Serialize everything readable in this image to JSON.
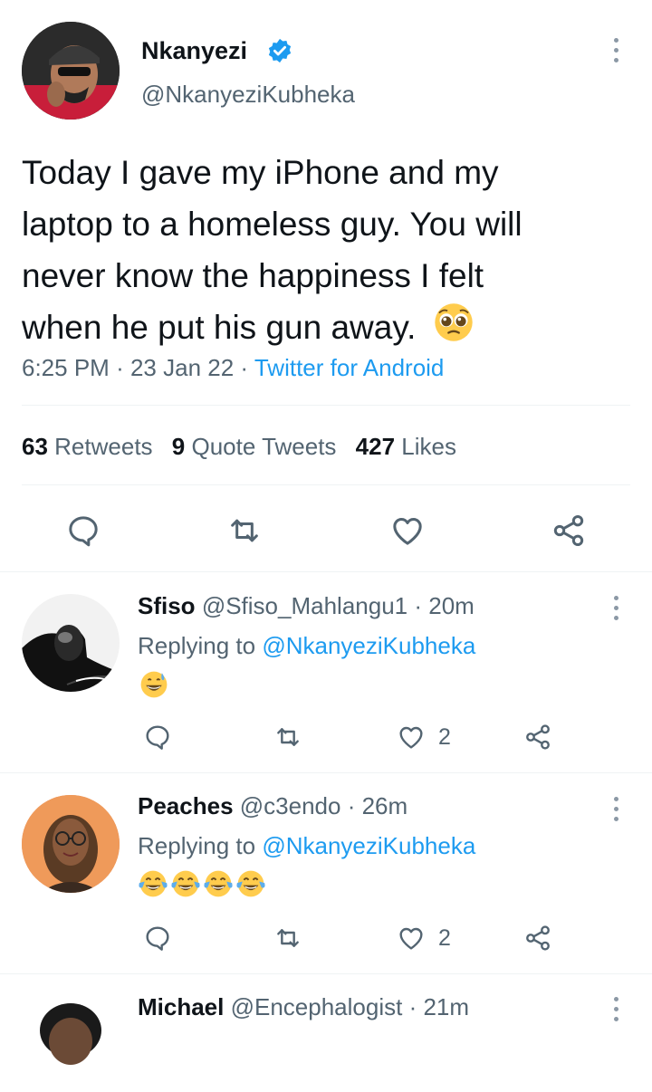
{
  "main_tweet": {
    "display_name": "Nkanyezi",
    "handle": "@NkanyeziKubheka",
    "verified": true,
    "text_lines": [
      "Today I gave my iPhone and my",
      "laptop to a homeless guy. You will",
      "never know the happiness I felt",
      "when he put his gun away."
    ],
    "emoji": "pleading-face",
    "time": "6:25 PM",
    "date": "23 Jan 22",
    "sep": "·",
    "source": "Twitter for Android",
    "retweets_count": "63",
    "retweets_label": "Retweets",
    "quotes_count": "9",
    "quotes_label": "Quote Tweets",
    "likes_count": "427",
    "likes_label": "Likes"
  },
  "replies": [
    {
      "display_name": "Sfiso",
      "handle": "@Sfiso_Mahlangu1",
      "time": "· 20m",
      "replying_label": "Replying to",
      "replying_handle": "@NkanyeziKubheka",
      "emoji": "grinning-face-with-sweat",
      "like_count": "2"
    },
    {
      "display_name": "Peaches",
      "handle": "@c3endo",
      "time": "· 26m",
      "replying_label": "Replying to",
      "replying_handle": "@NkanyeziKubheka",
      "emoji": "face-with-tears-of-joy x4",
      "like_count": "2"
    },
    {
      "display_name": "Michael",
      "handle": "@Encephalogist",
      "time": "· 21m"
    }
  ],
  "colors": {
    "accent": "#1d9bf0",
    "text": "#0f1419",
    "muted": "#536471",
    "divider": "#eff3f4"
  }
}
